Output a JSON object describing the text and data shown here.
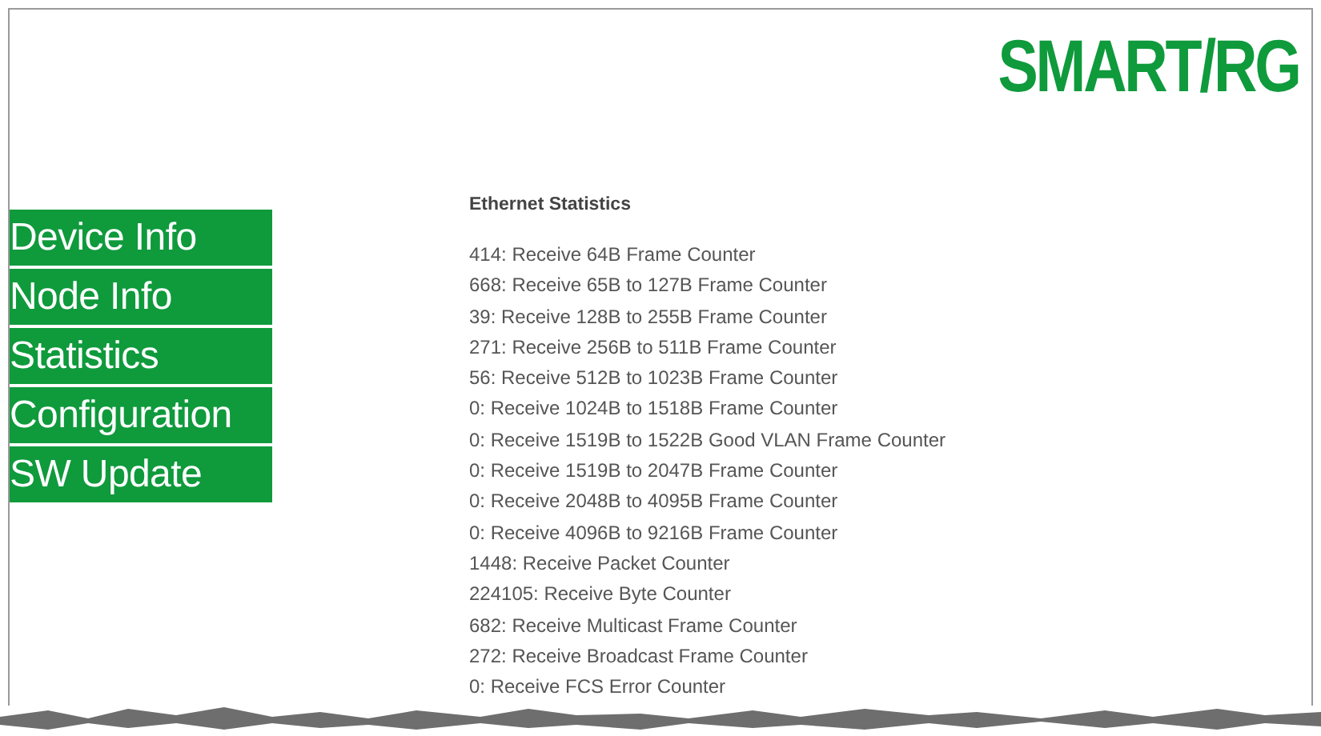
{
  "logo": "SMART/RG",
  "nav": [
    {
      "label": "Device Info"
    },
    {
      "label": "Node Info"
    },
    {
      "label": "Statistics"
    },
    {
      "label": "Configuration"
    },
    {
      "label": "SW Update"
    }
  ],
  "stats": {
    "title": "Ethernet Statistics",
    "lines": [
      "414: Receive 64B Frame Counter",
      "668: Receive 65B to 127B Frame Counter",
      "39: Receive 128B to 255B Frame Counter",
      "271: Receive 256B to 511B Frame Counter",
      "56: Receive 512B to 1023B Frame Counter",
      "0: Receive 1024B to 1518B Frame Counter",
      "0: Receive 1519B to 1522B Good VLAN Frame Counter",
      "0: Receive 1519B to 2047B Frame Counter",
      "0: Receive 2048B to 4095B Frame Counter",
      "0: Receive 4096B to 9216B Frame Counter",
      "1448: Receive Packet Counter",
      "224105: Receive Byte Counter",
      "682: Receive Multicast Frame Counter",
      "272: Receive Broadcast Frame Counter",
      "0: Receive FCS Error Counter"
    ]
  }
}
